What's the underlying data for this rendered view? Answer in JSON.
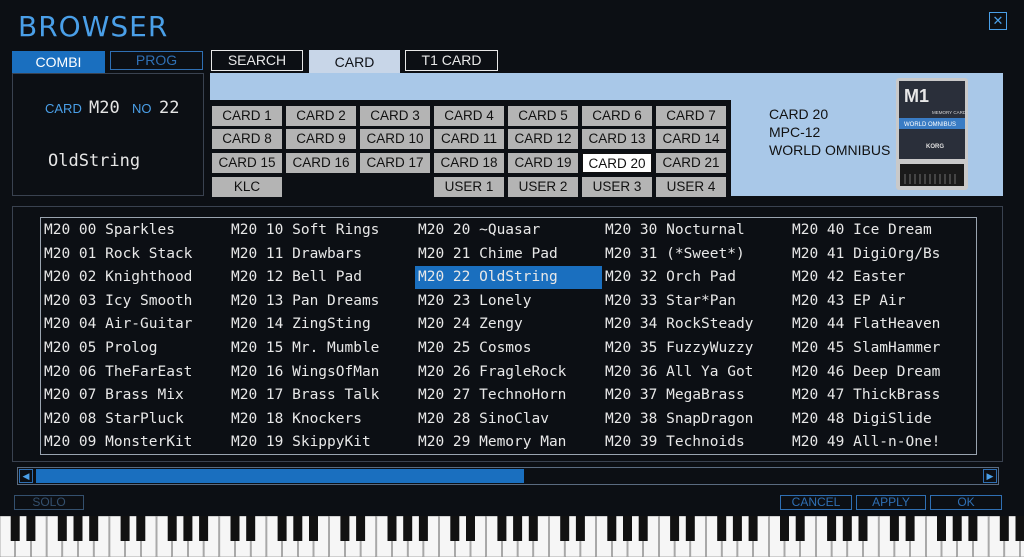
{
  "window": {
    "title": "BROWSER",
    "close_icon": "close-icon"
  },
  "mode_buttons": {
    "combi": "COMBI",
    "prog": "PROG"
  },
  "tabs": {
    "search": "SEARCH",
    "card": "CARD",
    "t1card": "T1 CARD"
  },
  "info": {
    "card_label": "CARD",
    "card_value": "M20",
    "no_label": "NO",
    "no_value": "22",
    "program_name": "OldString"
  },
  "card_buttons": [
    "CARD 1",
    "CARD 2",
    "CARD 3",
    "CARD 4",
    "CARD 5",
    "CARD 6",
    "CARD 7",
    "CARD 8",
    "CARD 9",
    "CARD 10",
    "CARD 11",
    "CARD 12",
    "CARD 13",
    "CARD 14",
    "CARD 15",
    "CARD 16",
    "CARD 17",
    "CARD 18",
    "CARD 19",
    "CARD 20",
    "CARD 21",
    "KLC",
    "USER 1",
    "USER 2",
    "USER 3",
    "USER 4"
  ],
  "selected_card": "CARD 20",
  "card_info": {
    "line1": "CARD 20",
    "line2": "MPC-12",
    "line3": "WORLD OMNIBUS"
  },
  "cartridge": {
    "logo": "M1",
    "sub1": "MEMORY CARD",
    "sub2": "WORLD OMNIBUS",
    "brand": "KORG"
  },
  "programs": [
    "M20 00 Sparkles",
    "M20 01 Rock Stack",
    "M20 02 Knighthood",
    "M20 03 Icy Smooth",
    "M20 04 Air-Guitar",
    "M20 05 Prolog",
    "M20 06 TheFarEast",
    "M20 07 Brass Mix",
    "M20 08 StarPluck",
    "M20 09 MonsterKit",
    "M20 10 Soft Rings",
    "M20 11 Drawbars",
    "M20 12 Bell Pad",
    "M20 13 Pan Dreams",
    "M20 14 ZingSting",
    "M20 15 Mr. Mumble",
    "M20 16 WingsOfMan",
    "M20 17 Brass Talk",
    "M20 18 Knockers",
    "M20 19 SkippyKit",
    "M20 20 ~Quasar",
    "M20 21 Chime Pad",
    "M20 22 OldString",
    "M20 23 Lonely",
    "M20 24 Zengy",
    "M20 25 Cosmos",
    "M20 26 FragleRock",
    "M20 27 TechnoHorn",
    "M20 28 SinoClav",
    "M20 29 Memory Man",
    "M20 30 Nocturnal",
    "M20 31 (*Sweet*)",
    "M20 32 Orch Pad",
    "M20 33 Star*Pan",
    "M20 34 RockSteady",
    "M20 35 FuzzyWuzzy",
    "M20 36 All Ya Got",
    "M20 37 MegaBrass",
    "M20 38 SnapDragon",
    "M20 39 Technoids",
    "M20 40 Ice Dream",
    "M20 41 DigiOrg/Bs",
    "M20 42 Easter",
    "M20 43 EP Air",
    "M20 44 FlatHeaven",
    "M20 45 SlamHammer",
    "M20 46 Deep Dream",
    "M20 47 ThickBrass",
    "M20 48 DigiSlide",
    "M20 49 All-n-One!"
  ],
  "selected_program_index": 22,
  "scrollbar": {
    "left_arrow": "left-arrow-icon",
    "right_arrow": "right-arrow-icon",
    "position": 0.5
  },
  "footer": {
    "solo": "SOLO",
    "cancel": "CANCEL",
    "apply": "APPLY",
    "ok": "OK"
  },
  "colors": {
    "accent": "#1a6fbf",
    "title": "#4a9fe8",
    "card_band": "#a9c8e8"
  }
}
